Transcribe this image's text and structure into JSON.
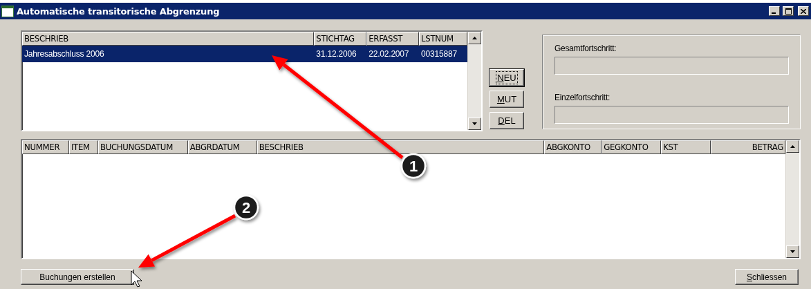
{
  "window": {
    "title": "Automatische transitorische Abgrenzung"
  },
  "journal_list": {
    "columns": [
      {
        "label": "BESCHRIEB"
      },
      {
        "label": "STICHTAG"
      },
      {
        "label": "ERFASST"
      },
      {
        "label": "LSTNUM"
      }
    ],
    "rows": [
      {
        "cells": [
          "Jahresabschluss 2006",
          "31.12.2006",
          "22.02.2007",
          "00315887"
        ],
        "selected": true
      }
    ]
  },
  "list_buttons": [
    {
      "label": "NEU",
      "mnemonic": true,
      "focused": true
    },
    {
      "label": "MUT",
      "mnemonic": true,
      "focused": false
    },
    {
      "label": "DEL",
      "mnemonic": true,
      "focused": false
    }
  ],
  "progress": [
    {
      "label": "Gesamtfortschritt:",
      "level": 0
    },
    {
      "label": "Einzelfortschritt:",
      "level": 0
    }
  ],
  "bookings_table": {
    "columns": [
      {
        "label": "NUMMER",
        "right_aligned": false
      },
      {
        "label": "ITEM",
        "right_aligned": false
      },
      {
        "label": "BUCHUNGSDATUM",
        "right_aligned": false
      },
      {
        "label": "ABGRDATUM",
        "right_aligned": false
      },
      {
        "label": "BESCHRIEB",
        "right_aligned": false
      },
      {
        "label": "ABGKONTO",
        "right_aligned": false
      },
      {
        "label": "GEGKONTO",
        "right_aligned": false
      },
      {
        "label": "KST",
        "right_aligned": false
      },
      {
        "label": "BETRAG",
        "right_aligned": true
      }
    ]
  },
  "footer_buttons": [
    {
      "label": "Buchungen erstellen",
      "mnemonic": false
    },
    {
      "label": "Schliessen",
      "mnemonic": true
    }
  ],
  "callouts": [
    {
      "number": "1"
    },
    {
      "number": "2"
    }
  ]
}
